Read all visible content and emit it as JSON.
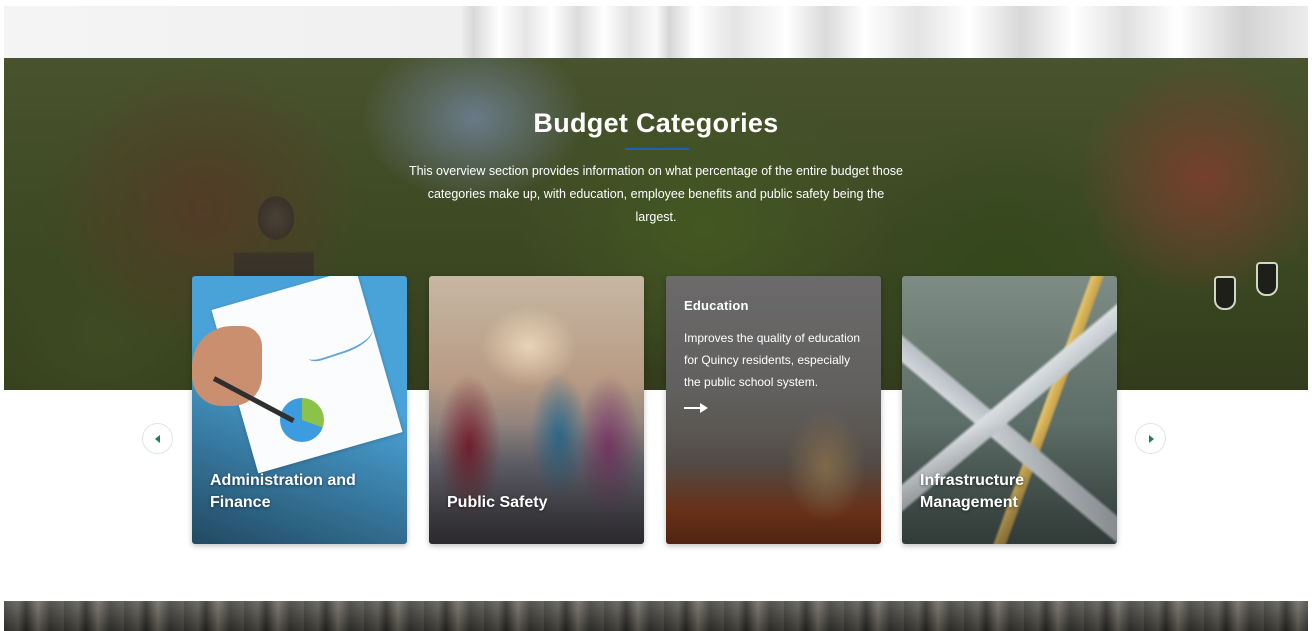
{
  "section": {
    "title": "Budget Categories",
    "description": "This overview section provides information on what percentage of the entire budget those categories make up, with education, employee benefits and public safety being the largest."
  },
  "carousel": {
    "prev_icon": "chevron-left-icon",
    "next_icon": "chevron-right-icon",
    "accent_color": "#1e7d5a",
    "cards": [
      {
        "title": "Administration and Finance"
      },
      {
        "title": "Public Safety"
      },
      {
        "title": "Education",
        "description": "Improves the quality of education for Quincy residents, especially the public school system.",
        "link_icon": "arrow-right-icon"
      },
      {
        "title": "Infrastructure Management"
      }
    ]
  },
  "colors": {
    "title_underline": "#1f5fc2",
    "text": "#ffffff"
  }
}
